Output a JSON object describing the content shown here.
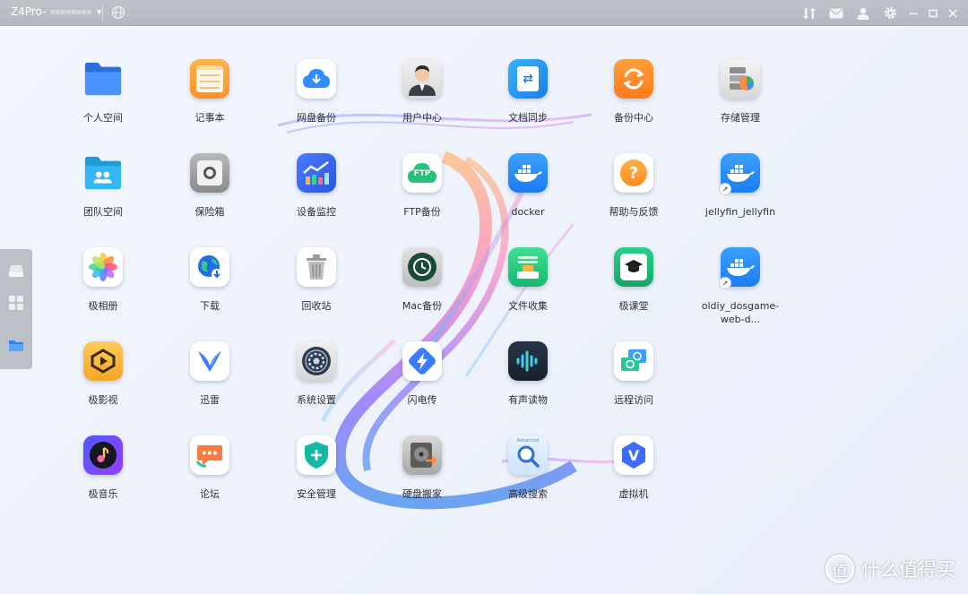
{
  "titlebar": {
    "device_name": "Z4Pro-",
    "device_suffix": "▪▪▪▪▪▪▪▪",
    "icons": [
      "transfer-icon",
      "mail-icon",
      "user-icon",
      "settings-icon",
      "minimize-icon",
      "maximize-icon",
      "close-icon"
    ]
  },
  "dock": {
    "icons": [
      "drive-icon",
      "apps-grid-icon",
      "folder-icon"
    ]
  },
  "apps": [
    {
      "label": "个人空间",
      "icon": "folder-icon"
    },
    {
      "label": "记事本",
      "icon": "notepad-icon"
    },
    {
      "label": "网盘备份",
      "icon": "cloud-backup-icon"
    },
    {
      "label": "用户中心",
      "icon": "user-center-icon"
    },
    {
      "label": "文档同步",
      "icon": "doc-sync-icon"
    },
    {
      "label": "备份中心",
      "icon": "backup-center-icon"
    },
    {
      "label": "存储管理",
      "icon": "storage-icon"
    },
    {
      "label": "团队空间",
      "icon": "team-folder-icon"
    },
    {
      "label": "保险箱",
      "icon": "safe-icon"
    },
    {
      "label": "设备监控",
      "icon": "monitor-chart-icon"
    },
    {
      "label": "FTP备份",
      "icon": "ftp-icon"
    },
    {
      "label": "docker",
      "icon": "docker-icon"
    },
    {
      "label": "帮助与反馈",
      "icon": "help-icon"
    },
    {
      "label": "jellyfin_jellyfin",
      "icon": "docker-icon"
    },
    {
      "label": "极相册",
      "icon": "photos-icon"
    },
    {
      "label": "下载",
      "icon": "download-globe-icon"
    },
    {
      "label": "回收站",
      "icon": "trash-icon"
    },
    {
      "label": "Mac备份",
      "icon": "time-machine-icon"
    },
    {
      "label": "文件收集",
      "icon": "file-collect-icon"
    },
    {
      "label": "极课堂",
      "icon": "graduation-cap-icon"
    },
    {
      "label": "oldiy_dosgame-web-d...",
      "icon": "docker-icon"
    },
    {
      "label": "极影视",
      "icon": "film-icon"
    },
    {
      "label": "迅雷",
      "icon": "thunder-bird-icon"
    },
    {
      "label": "系统设置",
      "icon": "system-settings-icon"
    },
    {
      "label": "闪电传",
      "icon": "lightning-icon"
    },
    {
      "label": "有声读物",
      "icon": "audiobook-icon"
    },
    {
      "label": "远程访问",
      "icon": "remote-access-icon"
    },
    {
      "label": "极音乐",
      "icon": "music-icon"
    },
    {
      "label": "论坛",
      "icon": "forum-icon"
    },
    {
      "label": "安全管理",
      "icon": "shield-icon"
    },
    {
      "label": "硬盘搬家",
      "icon": "disk-move-icon"
    },
    {
      "label": "高级搜索",
      "icon": "search-icon"
    },
    {
      "label": "虚拟机",
      "icon": "virtual-machine-icon"
    }
  ],
  "tile_text": {
    "ftp": "FTP",
    "vm": "V",
    "search_caption": "Advanced"
  },
  "watermark": {
    "text": "什么值得买",
    "logo": "值"
  },
  "colors": {
    "titlebar": "#b8bcc3",
    "dock": "#bcc1c8",
    "accent": "#2f80ed"
  }
}
